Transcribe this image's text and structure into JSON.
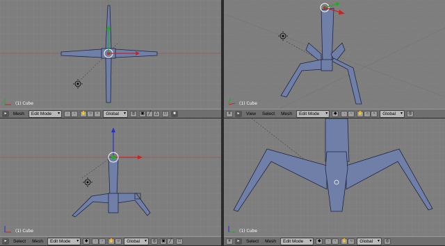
{
  "viewports": {
    "top_left": {
      "label": "(1) Cube"
    },
    "top_right": {
      "label": "(1) Cube"
    },
    "bottom_left": {
      "label": "(1) Cube"
    },
    "bottom_right": {
      "label": "(1) Cube"
    }
  },
  "headers": {
    "top_left": {
      "mesh": "Mesh",
      "mode": "Edit Mode",
      "orientation": "Global"
    },
    "top_right": {
      "view": "View",
      "select": "Select",
      "mesh": "Mesh",
      "mode": "Edit Mode",
      "orientation": "Global"
    },
    "bottom_left": {
      "select": "Select",
      "mesh": "Mesh",
      "mode": "Edit Mode",
      "orientation": "Global"
    },
    "bottom_right": {
      "select": "Select",
      "mesh": "Mesh",
      "mode": "Edit Mode",
      "orientation": "Global"
    }
  },
  "colors": {
    "viewport_bg": "#7e7e7e",
    "mesh_fill": "#6f7fa8",
    "mesh_edge": "#1e2640",
    "x_axis": "#cc2222",
    "y_axis": "#22aa22",
    "z_axis": "#2233cc",
    "header_bg": "#6f6f6f"
  },
  "icons": [
    "grid-icon",
    "menu-icon",
    "mesh-icon",
    "vertex-icon",
    "edge-icon",
    "face-icon",
    "snap-icon",
    "pivot-icon",
    "manipulator-icon",
    "lamp-icon",
    "camera-icon"
  ]
}
